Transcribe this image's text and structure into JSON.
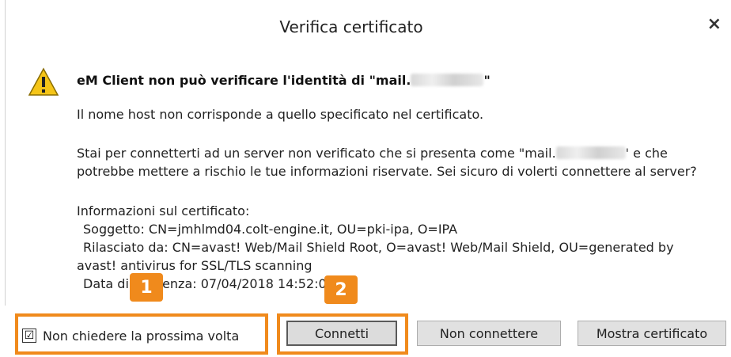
{
  "dialog": {
    "title": "Verifica certificato",
    "close_symbol": "×",
    "heading_prefix": "eM Client non può verificare l'identità di \"mail.",
    "heading_suffix": "\"",
    "line_mismatch": "Il nome host non corrisponde a quello specificato nel certificato.",
    "warning_line1_prefix": "Stai per connetterti ad un server non verificato che si presenta come \"mail.",
    "warning_line1_suffix": "' e che",
    "warning_line2": "potrebbe mettere a rischio le tue informazioni riservate. Sei sicuro di volerti connettere al server?",
    "cert_info_label": "Informazioni sul certificato:",
    "cert_subject": "Soggetto: CN=jmhlmd04.colt-engine.it, OU=pki-ipa, O=IPA",
    "cert_issuer_line1": "Rilasciato da: CN=avast! Web/Mail Shield Root, O=avast! Web/Mail Shield, OU=generated by",
    "cert_issuer_line2": "avast! antivirus for SSL/TLS scanning",
    "cert_expiry": "Data di scadenza: 07/04/2018 14:52:0"
  },
  "controls": {
    "dont_ask_label": "Non chiedere la prossima volta",
    "dont_ask_checked": "☑",
    "connect_label": "Connetti",
    "dont_connect_label": "Non connettere",
    "show_cert_label": "Mostra certificato"
  },
  "annotations": {
    "badge1": "1",
    "badge2": "2",
    "highlight_color": "#f08a1c"
  },
  "icons": {
    "warning": "warning-triangle-icon",
    "close": "close-icon"
  }
}
